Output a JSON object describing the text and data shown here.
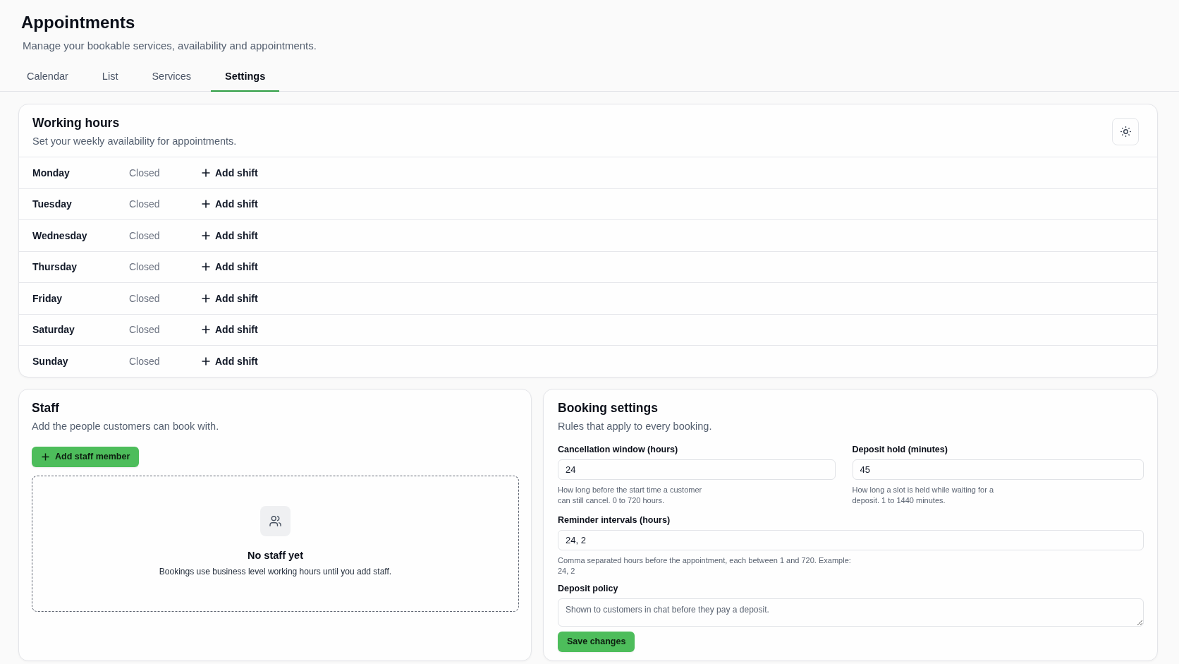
{
  "page": {
    "title": "Appointments",
    "subtitle": "Manage your bookable services, availability and appointments."
  },
  "tabs": [
    {
      "label": "Calendar",
      "selected": false
    },
    {
      "label": "List",
      "selected": false
    },
    {
      "label": "Services",
      "selected": false
    },
    {
      "label": "Settings",
      "selected": true
    }
  ],
  "working_hours": {
    "title": "Working hours",
    "subtitle": "Set your weekly availability for appointments.",
    "days": [
      {
        "day": "Monday",
        "status": "Closed",
        "action": "Add shift"
      },
      {
        "day": "Tuesday",
        "status": "Closed",
        "action": "Add shift"
      },
      {
        "day": "Wednesday",
        "status": "Closed",
        "action": "Add shift"
      },
      {
        "day": "Thursday",
        "status": "Closed",
        "action": "Add shift"
      },
      {
        "day": "Friday",
        "status": "Closed",
        "action": "Add shift"
      },
      {
        "day": "Saturday",
        "status": "Closed",
        "action": "Add shift"
      },
      {
        "day": "Sunday",
        "status": "Closed",
        "action": "Add shift"
      }
    ]
  },
  "staff": {
    "title": "Staff",
    "subtitle": "Add the people customers can book with.",
    "add_button": "Add staff member",
    "empty_state": {
      "title": "No staff yet",
      "message": "Bookings use business level working hours until you add staff."
    }
  },
  "booking_settings": {
    "title": "Booking settings",
    "subtitle": "Rules that apply to every booking.",
    "field_rows": [
      [
        {
          "kind": "input",
          "label": "Cancellation window (hours)",
          "value": "24",
          "help": "How long before the start time a customer can still cancel. 0 to 720 hours."
        },
        {
          "kind": "input",
          "label": "Deposit hold (minutes)",
          "value": "45",
          "help": "How long a slot is held while waiting for a deposit. 1 to 1440 minutes."
        }
      ],
      [
        {
          "kind": "input",
          "label": "Reminder intervals (hours)",
          "value": "24, 2",
          "help": "Comma separated hours before the appointment, each between 1 and 720. Example: 24, 2"
        }
      ],
      [
        {
          "kind": "textarea",
          "label": "Deposit policy",
          "placeholder": "Shown to customers in chat before they pay a deposit."
        }
      ]
    ],
    "save_button": "Save changes"
  }
}
